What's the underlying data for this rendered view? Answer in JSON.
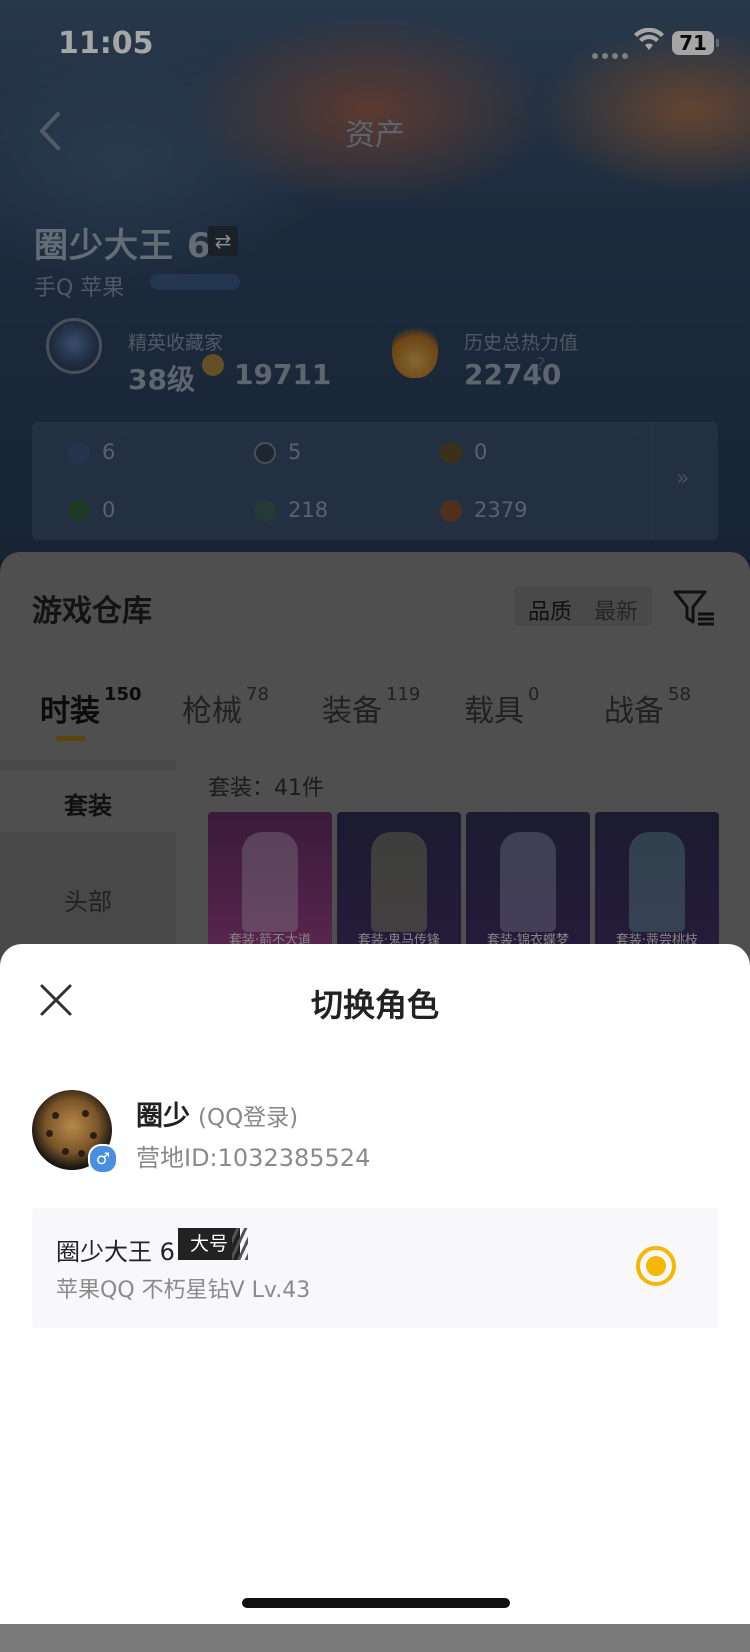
{
  "status_bar": {
    "time": "11:05",
    "battery": "71"
  },
  "nav": {
    "title": "资产"
  },
  "profile": {
    "name": "圈少大王 6",
    "platform": "手Q 苹果"
  },
  "stats": {
    "collector_label": "精英收藏家",
    "collector_level": "38级",
    "collector_points": "19711",
    "heat_label": "历史总热力值",
    "heat_value": "22740"
  },
  "resources": [
    "6",
    "5",
    "0",
    "0",
    "218",
    "2379"
  ],
  "warehouse": {
    "title": "游戏仓库",
    "sort_options": [
      "品质",
      "最新"
    ],
    "tabs": [
      {
        "label": "时装",
        "count": "150"
      },
      {
        "label": "枪械",
        "count": "78"
      },
      {
        "label": "装备",
        "count": "119"
      },
      {
        "label": "载具",
        "count": "0"
      },
      {
        "label": "战备",
        "count": "58"
      }
    ],
    "side_items": [
      "套装",
      "头部"
    ],
    "set_count": "套装：41件",
    "cards": [
      "套装·箭不大道",
      "套装·鬼马传锋",
      "套装·锦衣蝶梦",
      "套装·蒂尝桃枝"
    ]
  },
  "sheet": {
    "title": "切换角色",
    "account_name": "圈少",
    "account_login": "(QQ登录)",
    "account_id": "营地ID:1032385524",
    "gender_symbol": "♂",
    "role": {
      "name": "圈少大王 6",
      "tag": "大号",
      "info": "苹果QQ   不朽星钻V   Lv.43"
    }
  },
  "colors": {
    "accent": "#f5b800",
    "sheet_bg": "#ffffff",
    "tag_bg": "#222222"
  }
}
